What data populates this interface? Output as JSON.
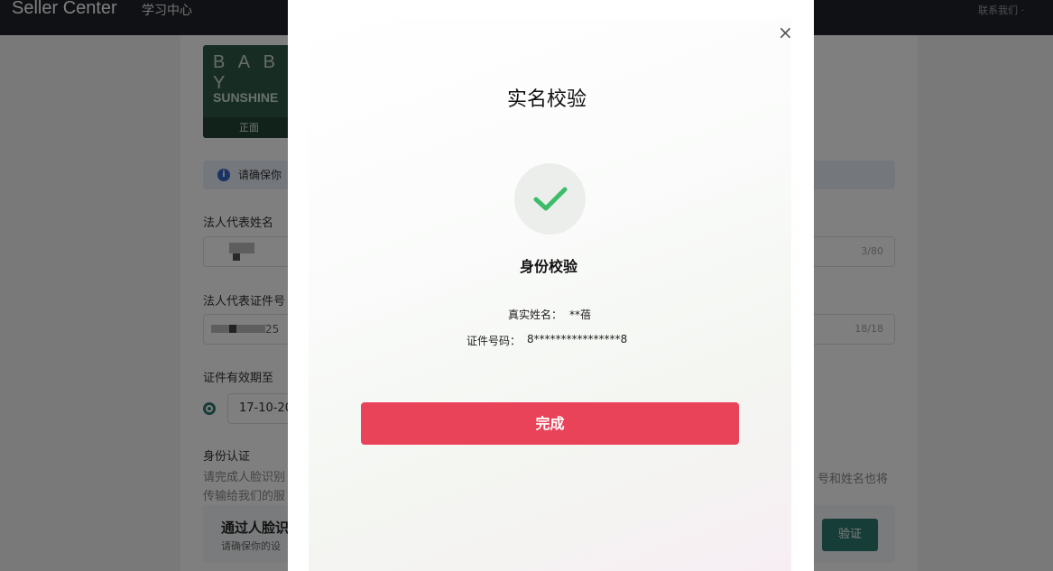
{
  "topbar": {
    "brand": "Seller Center",
    "learning": "学习中心",
    "contact": "联系我们 ·"
  },
  "brand_image": {
    "line1": "B A B Y",
    "line2": "SUNSHINE",
    "caption": "正面"
  },
  "alert": {
    "text": "请确保你"
  },
  "form": {
    "rep_name_label": "法人代表姓名",
    "rep_name_counter": "3/80",
    "rep_id_label": "法人代表证件号",
    "rep_id_counter": "18/18",
    "rep_id_partial": "25",
    "validity_label": "证件有效期至",
    "validity_value": "17-10-20",
    "identity_title": "身份认证",
    "identity_desc1": "请完成人脸识别",
    "identity_desc2": "传输给我们的服",
    "identity_tail": "号和姓名也将",
    "face_title": "通过人脸识",
    "face_sub": "请确保你的设",
    "verify_button": "验证"
  },
  "modal": {
    "close": "×",
    "title": "实名校验",
    "subtitle": "身份校验",
    "real_name_label": "真实姓名：",
    "real_name_value": "**蓓",
    "id_label": "证件号码：",
    "id_value": "8****************8",
    "done_button": "完成"
  },
  "colors": {
    "primary": "#2f7b73",
    "danger": "#e9435a",
    "topbar": "#1f2329",
    "success": "#3dbd6b"
  }
}
